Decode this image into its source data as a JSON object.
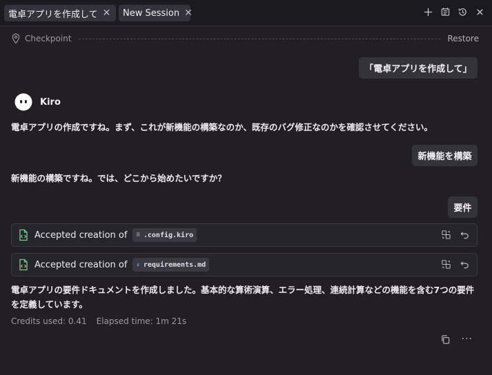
{
  "tabs": [
    {
      "label": "電卓アプリを作成して",
      "active": true
    },
    {
      "label": "New Session",
      "active": false
    }
  ],
  "toolbar": {
    "icons": [
      "plus-icon",
      "history-list-icon",
      "history-clock-icon",
      "close-icon"
    ]
  },
  "checkpoint": {
    "label": "Checkpoint",
    "restore": "Restore"
  },
  "conversation": {
    "user_messages": [
      "「電卓アプリを作成して」",
      "新機能を構築",
      "要件"
    ],
    "assistant_name": "Kiro",
    "assistant_messages": [
      "電卓アプリの作成ですね。まず、これが新機能の構築なのか、既存のバグ修正なのかを確認させてください。",
      "新機能の構築ですね。では、どこから始めたいですか？",
      "電卓アプリの要件ドキュメントを作成しました。基本的な算術演算、エラー処理、連続計算などの機能を含む7つの要件を定義しています。"
    ],
    "accepted": [
      {
        "label": "Accepted creation of",
        "file": ".config.kiro",
        "file_icon": "config-file-icon"
      },
      {
        "label": "Accepted creation of",
        "file": "requirements.md",
        "file_icon": "markdown-file-icon"
      }
    ]
  },
  "stats": {
    "credits": "Credits used: 0.41",
    "elapsed": "Elapsed time: 1m 21s"
  },
  "colors": {
    "background": "#211f25",
    "tabbar": "#1b1a1f",
    "bubble": "#35333a",
    "accent_green": "#6fcf8c"
  }
}
